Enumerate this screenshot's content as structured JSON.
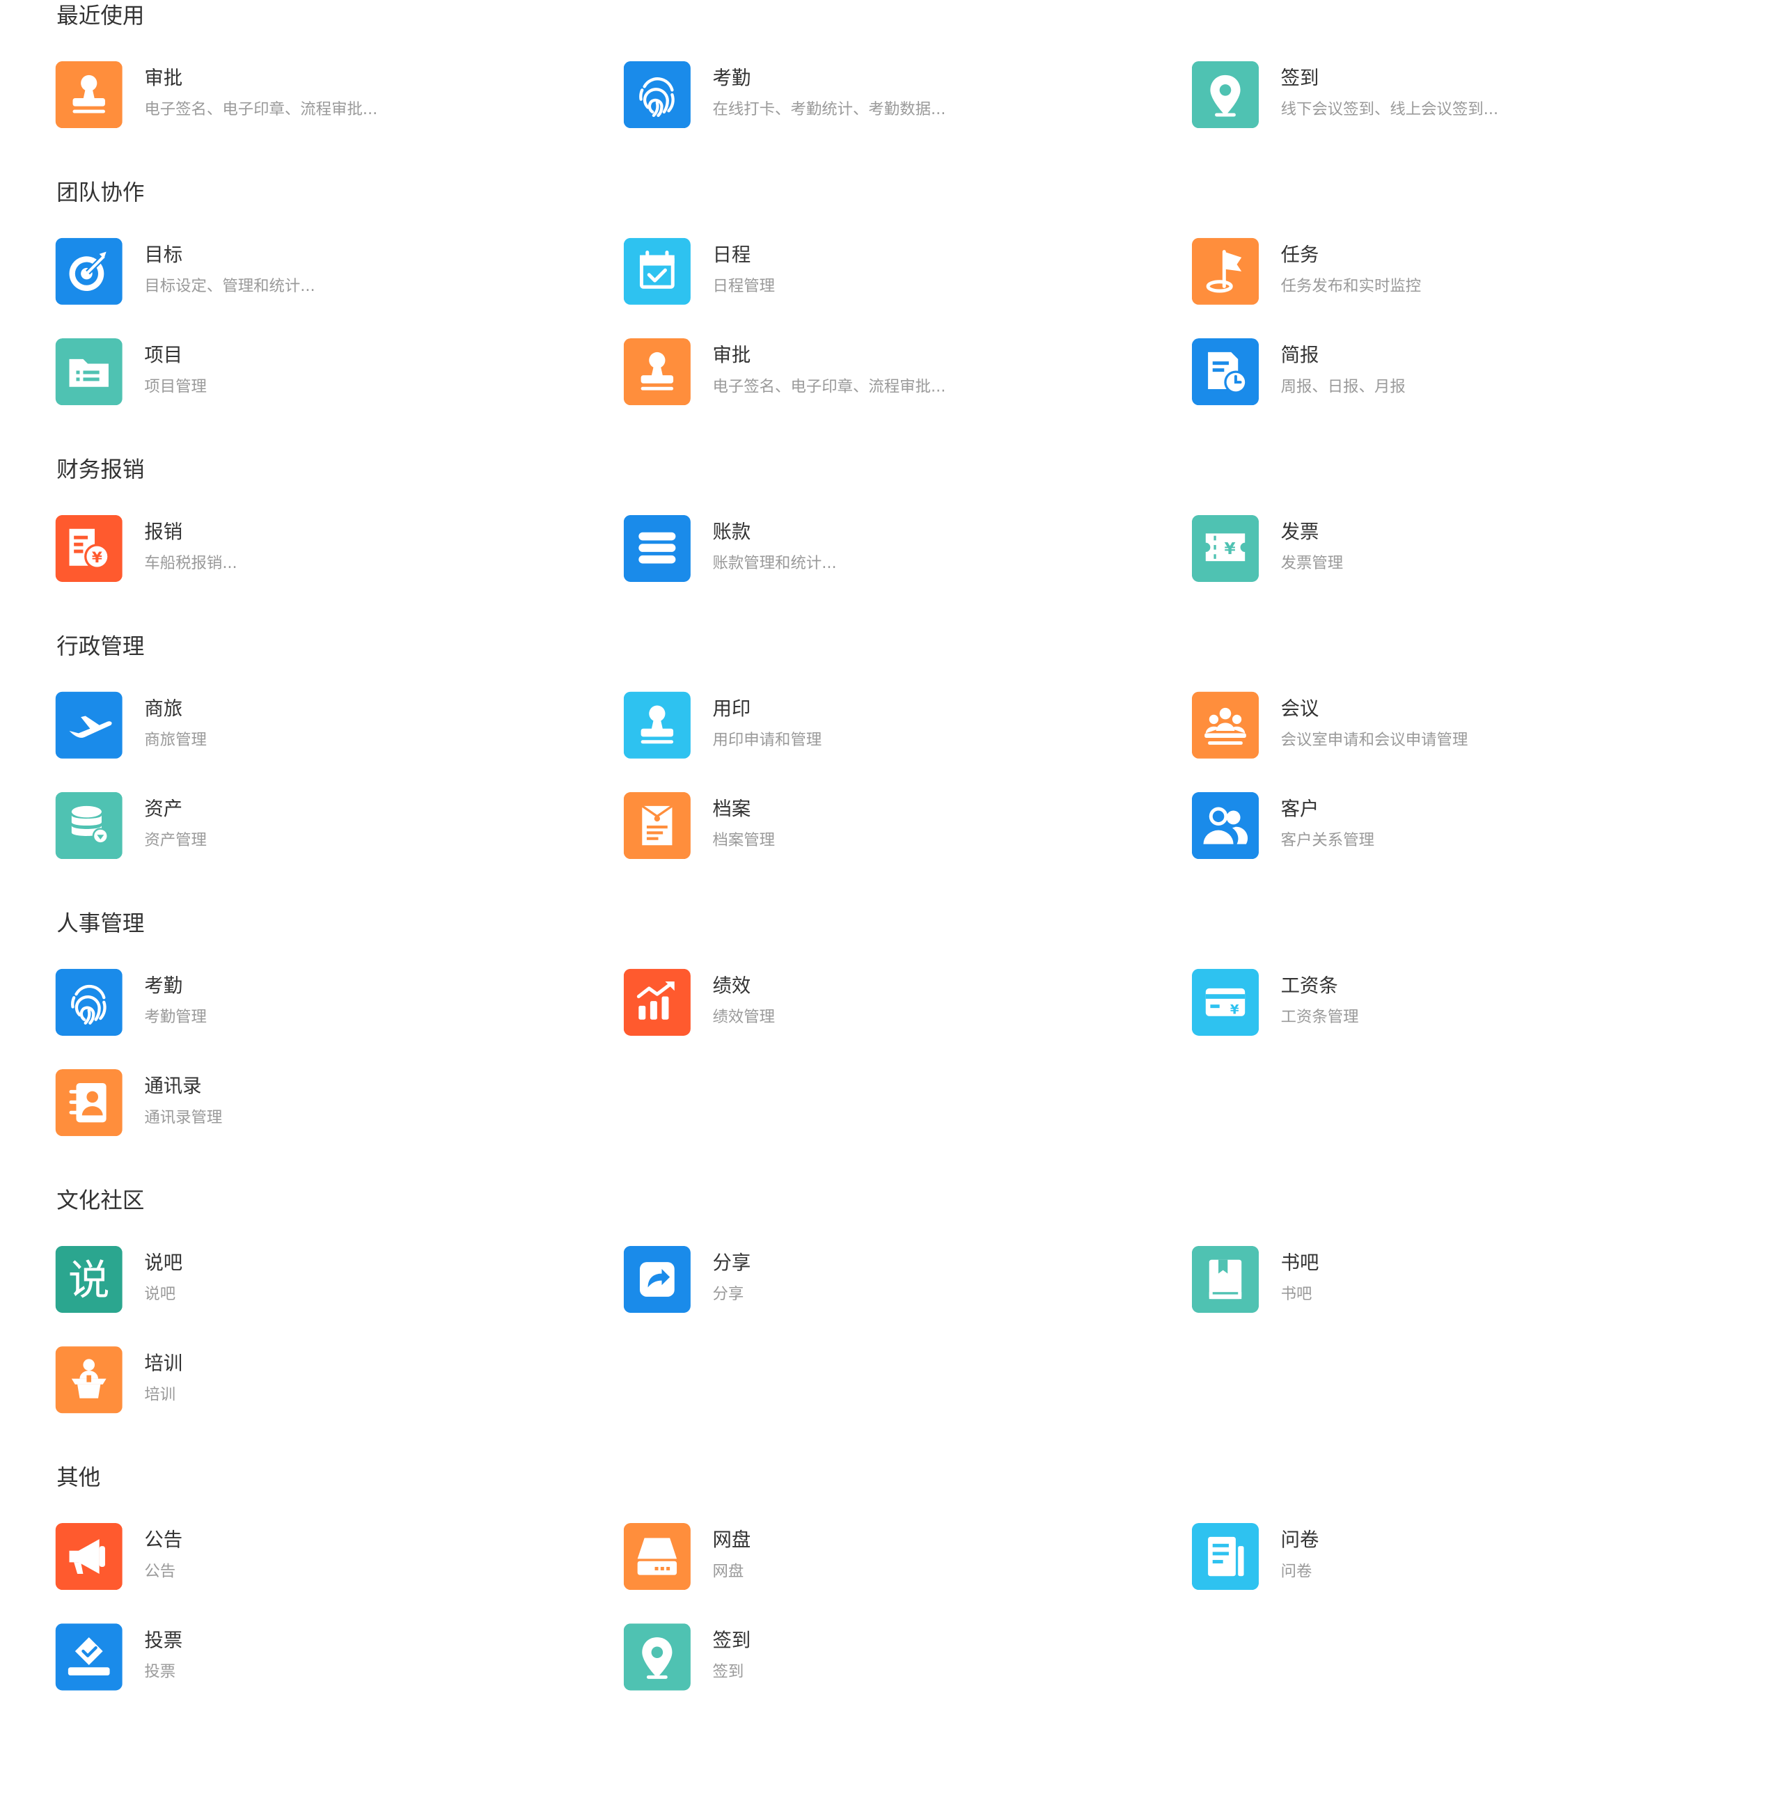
{
  "colors": {
    "orange": "#FF8E3C",
    "blue": "#1A8BEA",
    "teal": "#4FC2B2",
    "cyan": "#2EC2F0",
    "red": "#FF5A2E",
    "green": "#2BA68F",
    "title_text": "#333333",
    "desc_text": "#9A9A9A"
  },
  "sections": [
    {
      "title": "最近使用",
      "apps": [
        {
          "name": "审批",
          "desc": "电子签名、电子印章、流程审批...",
          "icon": "stamp-icon",
          "color": "orange"
        },
        {
          "name": "考勤",
          "desc": "在线打卡、考勤统计、考勤数据...",
          "icon": "fingerprint-icon",
          "color": "blue"
        },
        {
          "name": "签到",
          "desc": "线下会议签到、线上会议签到...",
          "icon": "location-pin-icon",
          "color": "teal"
        }
      ]
    },
    {
      "title": "团队协作",
      "apps": [
        {
          "name": "目标",
          "desc": "目标设定、管理和统计...",
          "icon": "target-icon",
          "color": "blue"
        },
        {
          "name": "日程",
          "desc": "日程管理",
          "icon": "calendar-check-icon",
          "color": "cyan"
        },
        {
          "name": "任务",
          "desc": "任务发布和实时监控",
          "icon": "flag-icon",
          "color": "orange"
        },
        {
          "name": "项目",
          "desc": "项目管理",
          "icon": "folder-list-icon",
          "color": "teal"
        },
        {
          "name": "审批",
          "desc": "电子签名、电子印章、流程审批...",
          "icon": "stamp-icon",
          "color": "orange"
        },
        {
          "name": "简报",
          "desc": "周报、日报、月报",
          "icon": "report-clock-icon",
          "color": "blue"
        }
      ]
    },
    {
      "title": "财务报销",
      "apps": [
        {
          "name": "报销",
          "desc": "车船税报销...",
          "icon": "reimburse-icon",
          "color": "red"
        },
        {
          "name": "账款",
          "desc": "账款管理和统计...",
          "icon": "stack-icon",
          "color": "blue"
        },
        {
          "name": "发票",
          "desc": "发票管理",
          "icon": "invoice-ticket-icon",
          "color": "teal"
        }
      ]
    },
    {
      "title": "行政管理",
      "apps": [
        {
          "name": "商旅",
          "desc": "商旅管理",
          "icon": "airplane-icon",
          "color": "blue"
        },
        {
          "name": "用印",
          "desc": "用印申请和管理",
          "icon": "stamp-icon",
          "color": "cyan"
        },
        {
          "name": "会议",
          "desc": "会议室申请和会议申请管理",
          "icon": "meeting-icon",
          "color": "orange"
        },
        {
          "name": "资产",
          "desc": "资产管理",
          "icon": "database-icon",
          "color": "teal"
        },
        {
          "name": "档案",
          "desc": "档案管理",
          "icon": "archive-icon",
          "color": "orange"
        },
        {
          "name": "客户",
          "desc": "客户关系管理",
          "icon": "users-icon",
          "color": "blue"
        }
      ]
    },
    {
      "title": "人事管理",
      "apps": [
        {
          "name": "考勤",
          "desc": "考勤管理",
          "icon": "fingerprint-icon",
          "color": "blue"
        },
        {
          "name": "绩效",
          "desc": "绩效管理",
          "icon": "chart-growth-icon",
          "color": "red"
        },
        {
          "name": "工资条",
          "desc": "工资条管理",
          "icon": "salary-card-icon",
          "color": "cyan"
        },
        {
          "name": "通讯录",
          "desc": "通讯录管理",
          "icon": "contacts-icon",
          "color": "orange"
        }
      ]
    },
    {
      "title": "文化社区",
      "apps": [
        {
          "name": "说吧",
          "desc": "说吧",
          "icon": "shuo-text-icon",
          "icon_text": "说",
          "color": "green"
        },
        {
          "name": "分享",
          "desc": "分享",
          "icon": "share-icon",
          "color": "blue"
        },
        {
          "name": "书吧",
          "desc": "书吧",
          "icon": "book-icon",
          "color": "teal"
        },
        {
          "name": "培训",
          "desc": "培训",
          "icon": "podium-icon",
          "color": "orange"
        }
      ]
    },
    {
      "title": "其他",
      "apps": [
        {
          "name": "公告",
          "desc": "公告",
          "icon": "megaphone-icon",
          "color": "red"
        },
        {
          "name": "网盘",
          "desc": "网盘",
          "icon": "disk-drive-icon",
          "color": "orange"
        },
        {
          "name": "问卷",
          "desc": "问卷",
          "icon": "questionnaire-icon",
          "color": "cyan"
        },
        {
          "name": "投票",
          "desc": "投票",
          "icon": "vote-icon",
          "color": "blue"
        },
        {
          "name": "签到",
          "desc": "签到",
          "icon": "location-pin-icon",
          "color": "teal"
        }
      ]
    }
  ]
}
